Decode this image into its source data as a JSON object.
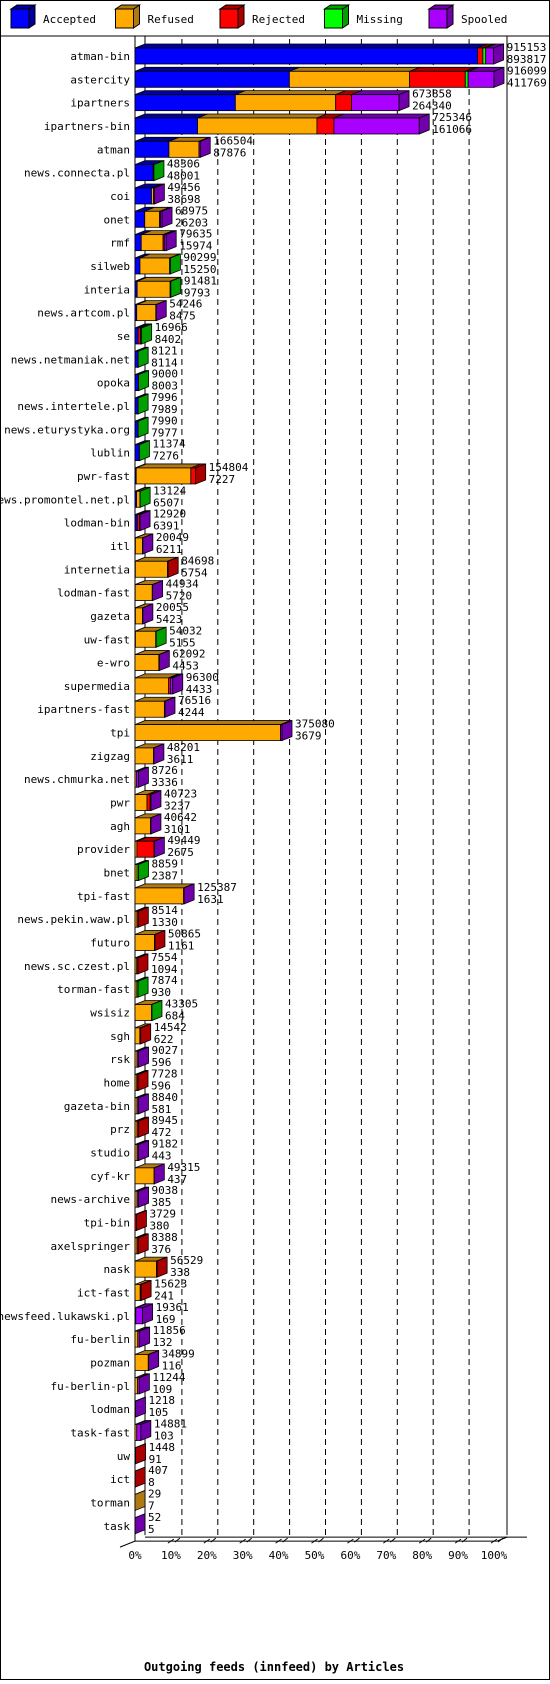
{
  "legend": [
    {
      "name": "Accepted",
      "color": "#0000ff",
      "side": "#00009c"
    },
    {
      "name": "Refused",
      "color": "#ffaa00",
      "side": "#b07a12"
    },
    {
      "name": "Rejected",
      "color": "#ff0000",
      "side": "#aa0000"
    },
    {
      "name": "Missing",
      "color": "#00ff00",
      "side": "#00a000"
    },
    {
      "name": "Spooled",
      "color": "#aa00ff",
      "side": "#7000aa"
    }
  ],
  "chart_data": {
    "type": "bar",
    "orientation": "horizontal",
    "stacked": true,
    "title": "Outgoing feeds (innfeed) by Articles",
    "xlabel": "Outgoing feeds (innfeed) by Articles",
    "xticks": [
      "0%",
      "10%",
      "20%",
      "30%",
      "40%",
      "50%",
      "60%",
      "70%",
      "80%",
      "90%",
      "100%"
    ],
    "xlim": [
      0,
      100
    ],
    "grid": true,
    "legend_position": "top",
    "series_names": [
      "Accepted",
      "Refused",
      "Rejected",
      "Missing",
      "Spooled"
    ],
    "note": "segment values are approximate fractions of each row total read from bar lengths; total = first printed number, second printed number shown below it",
    "rows": [
      {
        "label": "atman-bin",
        "total": 915153,
        "second": 893817,
        "fractions": [
          0.955,
          0,
          0.015,
          0.008,
          0.022
        ]
      },
      {
        "label": "astercity",
        "total": 916099,
        "second": 411769,
        "fractions": [
          0.43,
          0.335,
          0.155,
          0.008,
          0.072
        ]
      },
      {
        "label": "ipartners",
        "total": 673858,
        "second": 264340,
        "fractions": [
          0.38,
          0.38,
          0.06,
          0,
          0.18
        ]
      },
      {
        "label": "ipartners-bin",
        "total": 725346,
        "second": 161066,
        "fractions": [
          0.22,
          0.42,
          0.06,
          0,
          0.3
        ]
      },
      {
        "label": "atman",
        "total": 166504,
        "second": 87876,
        "fractions": [
          0.52,
          0.46,
          0,
          0,
          0.02
        ]
      },
      {
        "label": "news.connecta.pl",
        "total": 48306,
        "second": 48001,
        "fractions": [
          0.96,
          0,
          0,
          0.04,
          0
        ]
      },
      {
        "label": "coi",
        "total": 49456,
        "second": 38698,
        "fractions": [
          0.85,
          0.1,
          0,
          0,
          0.05
        ]
      },
      {
        "label": "onet",
        "total": 68975,
        "second": 26203,
        "fractions": [
          0.36,
          0.55,
          0.03,
          0,
          0.06
        ]
      },
      {
        "label": "rmf",
        "total": 79635,
        "second": 15974,
        "fractions": [
          0.2,
          0.7,
          0.04,
          0,
          0.06
        ]
      },
      {
        "label": "silweb",
        "total": 90299,
        "second": 15250,
        "fractions": [
          0.14,
          0.84,
          0,
          0.02,
          0
        ]
      },
      {
        "label": "interia",
        "total": 91481,
        "second": 9793,
        "fractions": [
          0.06,
          0.92,
          0,
          0.02,
          0
        ]
      },
      {
        "label": "news.artcom.pl",
        "total": 54246,
        "second": 8475,
        "fractions": [
          0.08,
          0.9,
          0,
          0,
          0.02
        ]
      },
      {
        "label": "se",
        "total": 16966,
        "second": 8402,
        "fractions": [
          0.48,
          0,
          0.35,
          0.17,
          0
        ]
      },
      {
        "label": "news.netmaniak.net",
        "total": 8121,
        "second": 8114,
        "fractions": [
          0.95,
          0,
          0,
          0.05,
          0
        ]
      },
      {
        "label": "opoka",
        "total": 9000,
        "second": 8003,
        "fractions": [
          0.95,
          0,
          0,
          0.05,
          0
        ]
      },
      {
        "label": "news.intertele.pl",
        "total": 7996,
        "second": 7989,
        "fractions": [
          0.95,
          0,
          0,
          0.05,
          0
        ]
      },
      {
        "label": "news.eturystyka.org",
        "total": 7990,
        "second": 7977,
        "fractions": [
          0.95,
          0,
          0,
          0.05,
          0
        ]
      },
      {
        "label": "lublin",
        "total": 11374,
        "second": 7276,
        "fractions": [
          0.95,
          0,
          0,
          0.05,
          0
        ]
      },
      {
        "label": "pwr-fast",
        "total": 154804,
        "second": 7227,
        "fractions": [
          0.02,
          0.9,
          0.08,
          0,
          0
        ]
      },
      {
        "label": "news.promontel.net.pl",
        "total": 13124,
        "second": 6507,
        "fractions": [
          0.3,
          0.65,
          0,
          0.05,
          0
        ]
      },
      {
        "label": "lodman-bin",
        "total": 12920,
        "second": 6391,
        "fractions": [
          0.45,
          0,
          0.45,
          0,
          0.1
        ]
      },
      {
        "label": "itl",
        "total": 20049,
        "second": 6211,
        "fractions": [
          0.05,
          0.9,
          0,
          0,
          0.05
        ]
      },
      {
        "label": "internetia",
        "total": 84698,
        "second": 5754,
        "fractions": [
          0.01,
          0.97,
          0.02,
          0,
          0
        ]
      },
      {
        "label": "lodman-fast",
        "total": 44934,
        "second": 5720,
        "fractions": [
          0.01,
          0.97,
          0,
          0,
          0.02
        ]
      },
      {
        "label": "gazeta",
        "total": 20055,
        "second": 5423,
        "fractions": [
          0.05,
          0.9,
          0,
          0,
          0.05
        ]
      },
      {
        "label": "uw-fast",
        "total": 54032,
        "second": 5155,
        "fractions": [
          0.02,
          0.96,
          0,
          0.02,
          0
        ]
      },
      {
        "label": "e-wro",
        "total": 62092,
        "second": 4453,
        "fractions": [
          0,
          0.98,
          0,
          0,
          0.02
        ]
      },
      {
        "label": "supermedia",
        "total": 96300,
        "second": 4433,
        "fractions": [
          0,
          0.89,
          0.05,
          0,
          0.06
        ]
      },
      {
        "label": "ipartners-fast",
        "total": 76516,
        "second": 4244,
        "fractions": [
          0,
          0.98,
          0,
          0,
          0.02
        ]
      },
      {
        "label": "tpi",
        "total": 375080,
        "second": 3679,
        "fractions": [
          0,
          0.99,
          0,
          0,
          0.01
        ]
      },
      {
        "label": "zigzag",
        "total": 48201,
        "second": 3611,
        "fractions": [
          0,
          0.98,
          0,
          0,
          0.02
        ]
      },
      {
        "label": "news.chmurka.net",
        "total": 8726,
        "second": 3336,
        "fractions": [
          0,
          0.4,
          0,
          0,
          0.6
        ]
      },
      {
        "label": "pwr",
        "total": 40723,
        "second": 3237,
        "fractions": [
          0,
          0.75,
          0.2,
          0,
          0.05
        ]
      },
      {
        "label": "agh",
        "total": 40642,
        "second": 3101,
        "fractions": [
          0,
          0.98,
          0,
          0,
          0.02
        ]
      },
      {
        "label": "provider",
        "total": 49449,
        "second": 2675,
        "fractions": [
          0,
          0.1,
          0.88,
          0,
          0.02
        ]
      },
      {
        "label": "bnet",
        "total": 8859,
        "second": 2387,
        "fractions": [
          0,
          0.6,
          0,
          0.4,
          0
        ]
      },
      {
        "label": "tpi-fast",
        "total": 125387,
        "second": 1631,
        "fractions": [
          0,
          0.99,
          0,
          0,
          0.01
        ]
      },
      {
        "label": "news.pekin.waw.pl",
        "total": 8514,
        "second": 1330,
        "fractions": [
          0,
          0.6,
          0.4,
          0,
          0
        ]
      },
      {
        "label": "futuro",
        "total": 50865,
        "second": 1161,
        "fractions": [
          0,
          0.98,
          0.02,
          0,
          0
        ]
      },
      {
        "label": "news.sc.czest.pl",
        "total": 7554,
        "second": 1094,
        "fractions": [
          0,
          0.6,
          0.4,
          0,
          0
        ]
      },
      {
        "label": "torman-fast",
        "total": 7874,
        "second": 930,
        "fractions": [
          0,
          0.6,
          0,
          0.4,
          0
        ]
      },
      {
        "label": "wsisiz",
        "total": 43305,
        "second": 684,
        "fractions": [
          0,
          0.98,
          0,
          0.02,
          0
        ]
      },
      {
        "label": "sgh",
        "total": 14542,
        "second": 622,
        "fractions": [
          0,
          0.85,
          0.15,
          0,
          0
        ]
      },
      {
        "label": "rsk",
        "total": 9027,
        "second": 596,
        "fractions": [
          0,
          0.6,
          0,
          0,
          0.4
        ]
      },
      {
        "label": "home",
        "total": 7728,
        "second": 596,
        "fractions": [
          0,
          0.6,
          0.4,
          0,
          0
        ]
      },
      {
        "label": "gazeta-bin",
        "total": 8840,
        "second": 581,
        "fractions": [
          0,
          0.6,
          0,
          0,
          0.4
        ]
      },
      {
        "label": "prz",
        "total": 8945,
        "second": 472,
        "fractions": [
          0,
          0.6,
          0.4,
          0,
          0
        ]
      },
      {
        "label": "studio",
        "total": 9182,
        "second": 443,
        "fractions": [
          0,
          0.6,
          0,
          0,
          0.4
        ]
      },
      {
        "label": "cyf-kr",
        "total": 49315,
        "second": 437,
        "fractions": [
          0,
          0.99,
          0,
          0,
          0.01
        ]
      },
      {
        "label": "news-archive",
        "total": 9038,
        "second": 385,
        "fractions": [
          0,
          0.6,
          0,
          0,
          0.4
        ]
      },
      {
        "label": "tpi-bin",
        "total": 3729,
        "second": 380,
        "fractions": [
          0,
          0,
          1,
          0,
          0
        ]
      },
      {
        "label": "axelspringer",
        "total": 8388,
        "second": 376,
        "fractions": [
          0,
          0.6,
          0.4,
          0,
          0
        ]
      },
      {
        "label": "nask",
        "total": 56529,
        "second": 338,
        "fractions": [
          0,
          0.97,
          0.03,
          0,
          0
        ]
      },
      {
        "label": "ict-fast",
        "total": 15623,
        "second": 241,
        "fractions": [
          0,
          0.85,
          0.15,
          0,
          0
        ]
      },
      {
        "label": "newsfeed.lukawski.pl",
        "total": 19361,
        "second": 169,
        "fractions": [
          0,
          0.1,
          0,
          0,
          0.9
        ]
      },
      {
        "label": "fu-berlin",
        "total": 11856,
        "second": 132,
        "fractions": [
          0,
          0.6,
          0,
          0,
          0.4
        ]
      },
      {
        "label": "pozman",
        "total": 34899,
        "second": 116,
        "fractions": [
          0,
          0.97,
          0,
          0,
          0.03
        ]
      },
      {
        "label": "fu-berlin-pl",
        "total": 11244,
        "second": 109,
        "fractions": [
          0,
          0.6,
          0,
          0,
          0.4
        ]
      },
      {
        "label": "lodman",
        "total": 1218,
        "second": 105,
        "fractions": [
          0,
          0,
          0,
          0,
          1
        ]
      },
      {
        "label": "task-fast",
        "total": 14881,
        "second": 103,
        "fractions": [
          0,
          0.3,
          0,
          0,
          0.7
        ]
      },
      {
        "label": "uw",
        "total": 1448,
        "second": 91,
        "fractions": [
          0,
          0,
          1,
          0,
          0
        ]
      },
      {
        "label": "ict",
        "total": 407,
        "second": 8,
        "fractions": [
          0,
          0,
          1,
          0,
          0
        ]
      },
      {
        "label": "torman",
        "total": 29,
        "second": 7,
        "fractions": [
          0,
          1,
          0,
          0,
          0
        ]
      },
      {
        "label": "task",
        "total": 52,
        "second": 5,
        "fractions": [
          0,
          0,
          0,
          0,
          1
        ]
      }
    ]
  }
}
